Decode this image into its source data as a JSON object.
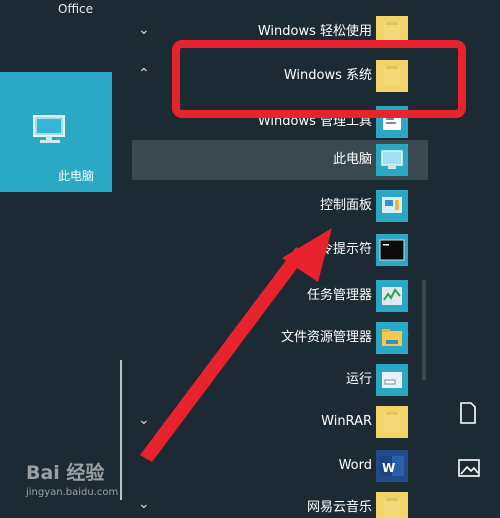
{
  "left": {
    "office_label": "Office",
    "tile": {
      "label": "此电脑",
      "icon": "computer-icon"
    },
    "watermark": {
      "line1": "Bai 经验",
      "line2": "jingyan.baidu.com"
    }
  },
  "start_menu": {
    "items": [
      {
        "label": "Windows 轻松使用",
        "icon": "folder-icon",
        "chevron": "expand"
      },
      {
        "label": "Windows 系统",
        "icon": "folder-icon",
        "chevron": "collapse"
      },
      {
        "label": "Windows 管理工具",
        "icon": "admin-tools-icon"
      },
      {
        "label": "此电脑",
        "icon": "computer-icon",
        "highlighted": true
      },
      {
        "label": "控制面板",
        "icon": "control-panel-icon"
      },
      {
        "label": "命令提示符",
        "icon": "cmd-icon"
      },
      {
        "label": "任务管理器",
        "icon": "task-manager-icon"
      },
      {
        "label": "文件资源管理器",
        "icon": "explorer-icon"
      },
      {
        "label": "运行",
        "icon": "run-icon"
      },
      {
        "label": "WinRAR",
        "icon": "folder-icon",
        "chevron": "expand"
      },
      {
        "label": "Word",
        "icon": "word-icon"
      },
      {
        "label": "网易云音乐",
        "icon": "folder-icon",
        "chevron": "expand"
      }
    ]
  },
  "right_rail": {
    "icons": [
      "document-icon",
      "pictures-icon"
    ]
  },
  "colors": {
    "background": "#1c2a33",
    "tile": "#2ba9c4",
    "highlight_annotation": "#e8232d"
  }
}
